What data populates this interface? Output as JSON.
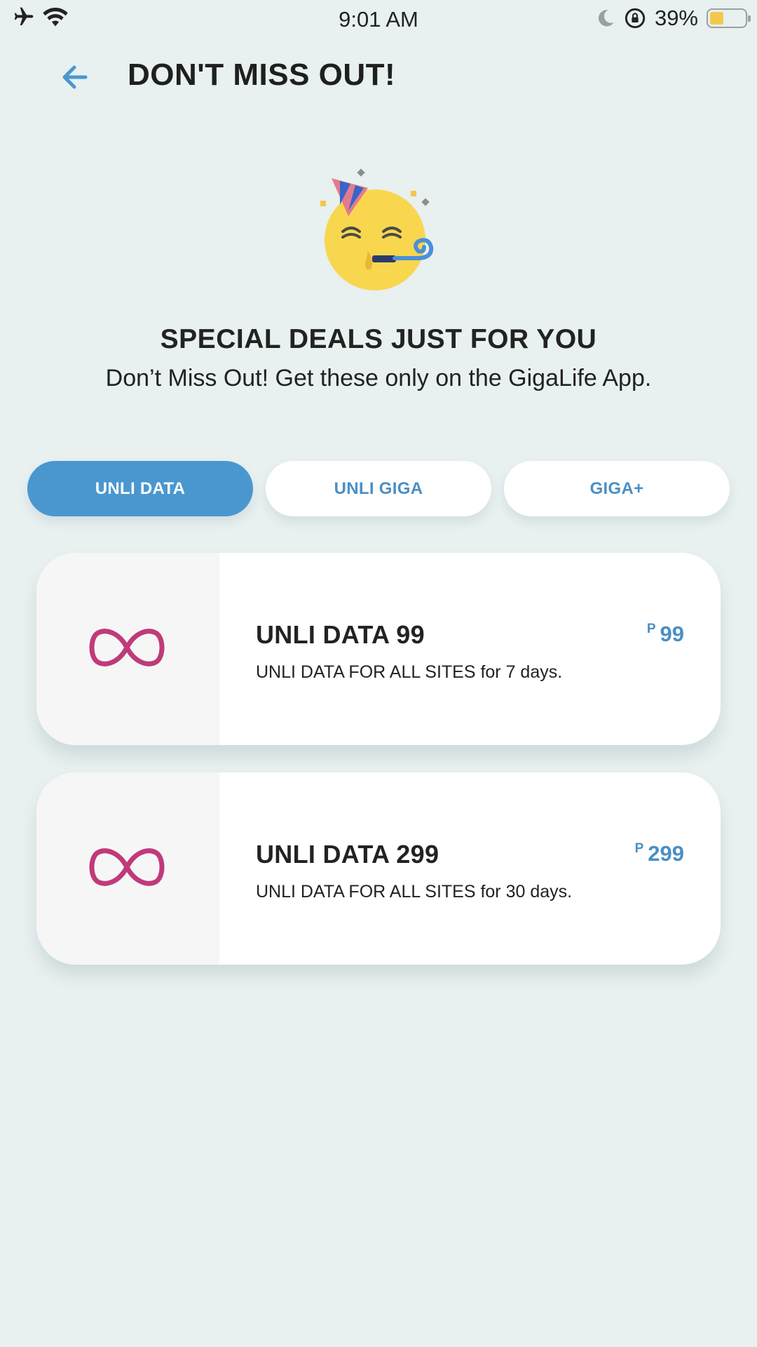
{
  "status_bar": {
    "time": "9:01 AM",
    "battery_percent": "39%",
    "battery_level": 0.39,
    "icons": [
      "airplane-icon",
      "wifi-icon",
      "moon-icon",
      "rotation-lock-icon",
      "battery-icon"
    ]
  },
  "header": {
    "title": "DON'T MISS OUT!",
    "back_icon": "back-arrow-icon"
  },
  "hero": {
    "icon": "party-face-emoji",
    "headline": "SPECIAL DEALS JUST FOR YOU",
    "subline": "Don’t Miss Out! Get these only on the GigaLife App."
  },
  "tabs": [
    {
      "label": "UNLI DATA",
      "active": true
    },
    {
      "label": "UNLI GIGA",
      "active": false
    },
    {
      "label": "GIGA+",
      "active": false
    }
  ],
  "offers": [
    {
      "icon": "infinity-icon",
      "title": "UNLI DATA 99",
      "description": "UNLI DATA FOR ALL SITES for 7 days.",
      "currency": "P",
      "price": "99"
    },
    {
      "icon": "infinity-icon",
      "title": "UNLI DATA 299",
      "description": "UNLI DATA FOR ALL SITES for 30 days.",
      "currency": "P",
      "price": "299"
    }
  ],
  "colors": {
    "background": "#e8f0f0",
    "accent": "#4a97d0",
    "price": "#4a8fc4",
    "infinity": "#c03a7a",
    "battery_fill": "#f2c94c"
  }
}
